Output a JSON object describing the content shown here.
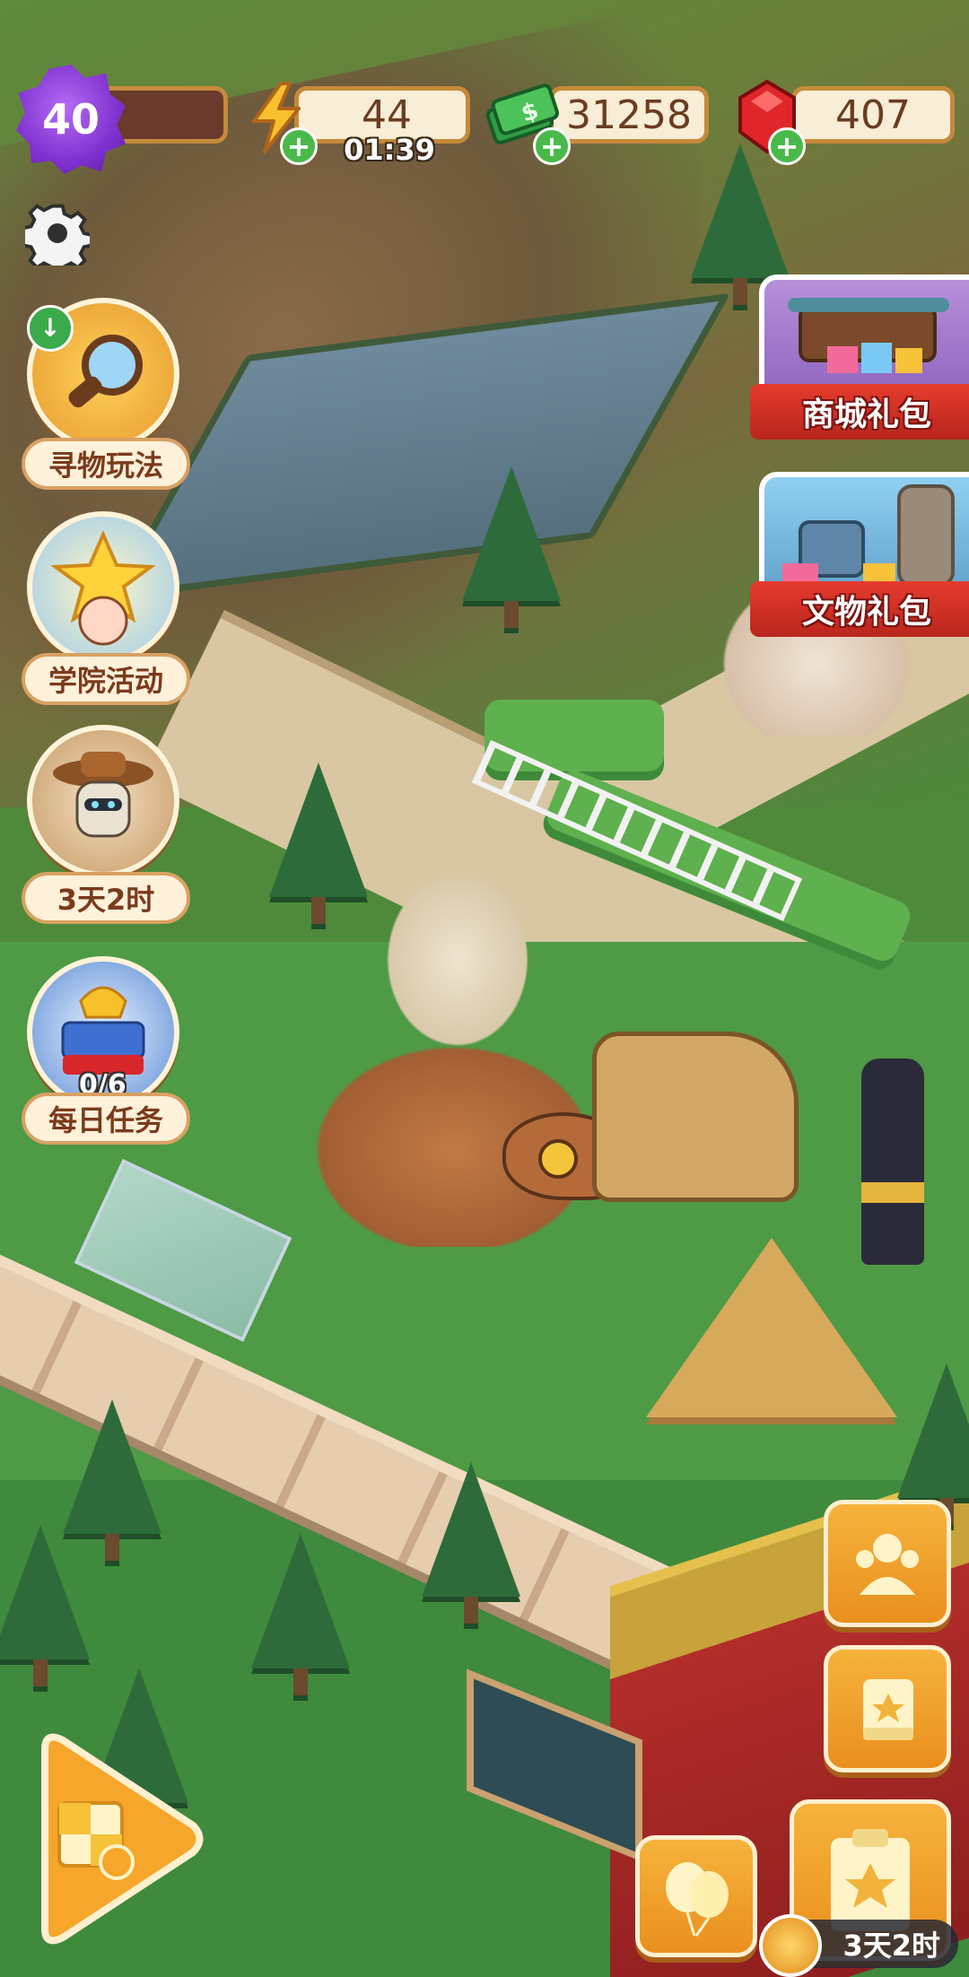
{
  "hud": {
    "level": "40",
    "energy": "44",
    "energy_timer": "01:39",
    "cash": "31258",
    "gems": "407",
    "plus": "+"
  },
  "left_features": [
    {
      "label": "寻物玩法",
      "icon": "magnifier-icon"
    },
    {
      "label": "学院活动",
      "icon": "star-student-icon"
    },
    {
      "label": "3天2时",
      "icon": "explorer-mummy-icon"
    },
    {
      "label": "每日任务",
      "icon": "treasure-chest-icon",
      "progress": "0/6"
    }
  ],
  "promos": [
    {
      "label": "商城礼包",
      "icon": "shop-gift-icon"
    },
    {
      "label": "文物礼包",
      "icon": "relic-gift-icon"
    }
  ],
  "right_buttons": [
    {
      "icon": "museum-guests-icon"
    },
    {
      "icon": "collection-book-icon"
    },
    {
      "icon": "clipboard-star-icon"
    },
    {
      "icon": "balloons-icon"
    }
  ],
  "bottom": {
    "play_icon": "merge-play-icon",
    "event_timer": "3天2时"
  },
  "colors": {
    "accent": "#ea8f1e",
    "level_purple": "#7f31d0",
    "promo_red": "#e63b2e",
    "label_text": "#7a3b1c"
  }
}
